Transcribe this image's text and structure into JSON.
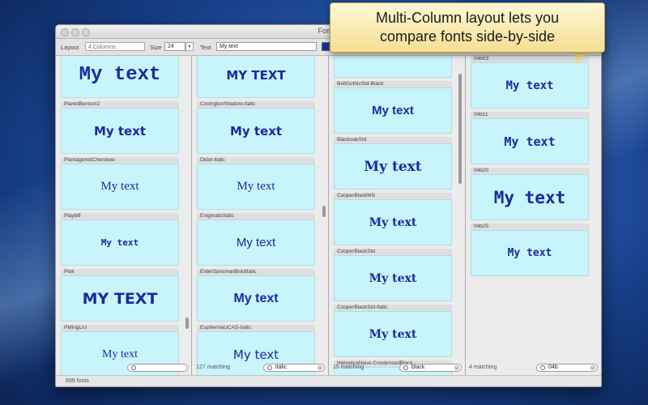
{
  "window": {
    "title": "FontPi"
  },
  "toolbar": {
    "layout_label": "Layout",
    "layout_value": "4 Columns",
    "size_label": "Size",
    "size_value": "24",
    "text_label": "Text",
    "text_value": "My text",
    "color": "#1a2aa8"
  },
  "callout": {
    "line1": "Multi-Column layout lets you",
    "line2": "compare fonts side-by-side"
  },
  "columns": [
    {
      "cards": [
        {
          "name": "",
          "sample": "My text",
          "font": "Liberation Mono",
          "size": "24px",
          "weight": "bold"
        },
        {
          "name": "PlanetBenson2",
          "sample": "My text",
          "font": "DejaVu Sans",
          "size": "15px",
          "weight": "bold"
        },
        {
          "name": "PlantagenetCherokee",
          "sample": "My text",
          "font": "Liberation Serif",
          "size": "15px",
          "weight": "normal"
        },
        {
          "name": "Playbill",
          "sample": "My text",
          "font": "DejaVu Sans Mono",
          "size": "11px",
          "weight": "bold"
        },
        {
          "name": "Plok",
          "sample": "MY TEXT",
          "font": "DejaVu Sans",
          "size": "19px",
          "weight": "bold"
        },
        {
          "name": "PMingLiU",
          "sample": "My text",
          "font": "Liberation Serif",
          "size": "14px",
          "weight": "normal"
        }
      ],
      "footer_count": "",
      "search": ""
    },
    {
      "cards": [
        {
          "name": "",
          "sample": "MY TEXT",
          "font": "DejaVu Sans",
          "size": "15px",
          "weight": "bold"
        },
        {
          "name": "CovingtonShadow-Italic",
          "sample": "My text",
          "font": "DejaVu Sans",
          "size": "15px",
          "weight": "bold"
        },
        {
          "name": "Didot-Italic",
          "sample": "My text",
          "font": "Liberation Serif",
          "size": "15px",
          "weight": "normal"
        },
        {
          "name": "EnigmaticItalic",
          "sample": "My text",
          "font": "Liberation Sans",
          "size": "15px",
          "weight": "normal"
        },
        {
          "name": "EnterSansmanBoldItalic",
          "sample": "My text",
          "font": "Liberation Sans",
          "size": "16px",
          "weight": "bold"
        },
        {
          "name": "EuphemiaUCAS-Italic",
          "sample": "My text",
          "font": "DejaVu Sans",
          "size": "15px",
          "weight": "normal"
        }
      ],
      "footer_count": "127 matching",
      "search": "italic"
    },
    {
      "cards": [
        {
          "name": "",
          "sample": "",
          "font": "Liberation Sans",
          "size": "15px",
          "weight": "bold"
        },
        {
          "name": "BellGothicStd-Black",
          "sample": "My text",
          "font": "Liberation Sans",
          "size": "15px",
          "weight": "bold"
        },
        {
          "name": "BlackoakStd",
          "sample": "My text",
          "font": "DejaVu Serif",
          "size": "17px",
          "weight": "bold"
        },
        {
          "name": "CooperBlackMS",
          "sample": "My text",
          "font": "DejaVu Serif",
          "size": "14px",
          "weight": "bold"
        },
        {
          "name": "CooperBlackStd",
          "sample": "My text",
          "font": "DejaVu Serif",
          "size": "14px",
          "weight": "bold"
        },
        {
          "name": "CooperBlackStd-Italic",
          "sample": "My text",
          "font": "DejaVu Serif",
          "size": "14px",
          "weight": "bold"
        },
        {
          "name": "HelveticaNeue-CondensedBlack",
          "sample": "",
          "font": "Liberation Sans",
          "size": "14px",
          "weight": "bold"
        }
      ],
      "footer_count": "15 matching",
      "search": "black"
    },
    {
      "cards": [
        {
          "name": "04b03",
          "sample": "My text",
          "font": "DejaVu Sans Mono",
          "size": "14px",
          "weight": "bold"
        },
        {
          "name": "04b11",
          "sample": "My text",
          "font": "DejaVu Sans Mono",
          "size": "15px",
          "weight": "bold"
        },
        {
          "name": "04b20",
          "sample": "My text",
          "font": "DejaVu Sans Mono",
          "size": "21px",
          "weight": "bold"
        },
        {
          "name": "04b25",
          "sample": "My text",
          "font": "DejaVu Sans Mono",
          "size": "13px",
          "weight": "bold"
        }
      ],
      "footer_count": "4 matching",
      "search": "04b"
    }
  ],
  "status": {
    "total": "699 fonts"
  }
}
